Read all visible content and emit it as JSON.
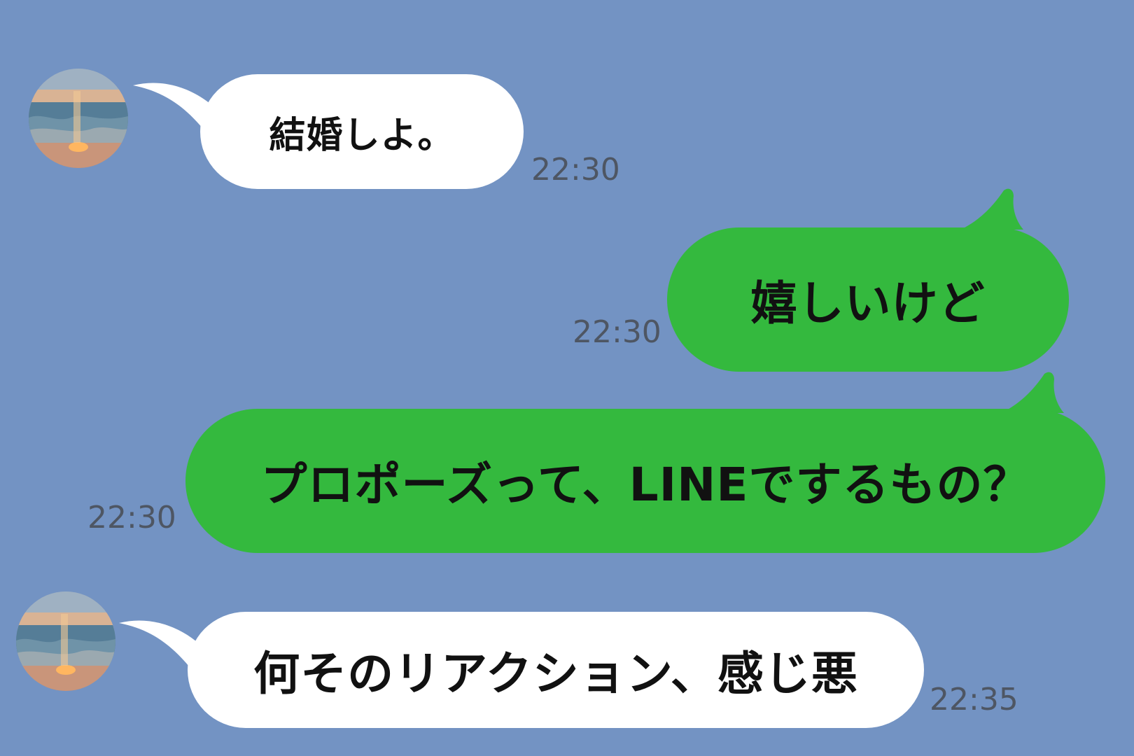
{
  "chat": {
    "messages": [
      {
        "sender": "other",
        "text": "結婚しよ。",
        "time": "22:30",
        "has_avatar": true
      },
      {
        "sender": "me",
        "text": "嬉しいけど",
        "time": "22:30",
        "has_avatar": false
      },
      {
        "sender": "me",
        "text": "プロポーズって、LINEでするもの？",
        "time": "22:30",
        "has_avatar": false
      },
      {
        "sender": "other",
        "text": "何そのリアクション、感じ悪",
        "time": "22:35",
        "has_avatar": true
      }
    ]
  },
  "colors": {
    "background": "#7393c3",
    "incoming_bubble": "#ffffff",
    "outgoing_bubble": "#34b93e",
    "text": "#111111",
    "timestamp": "#4e5663"
  },
  "icons": {
    "avatar": "sunset-sea-avatar-icon"
  }
}
